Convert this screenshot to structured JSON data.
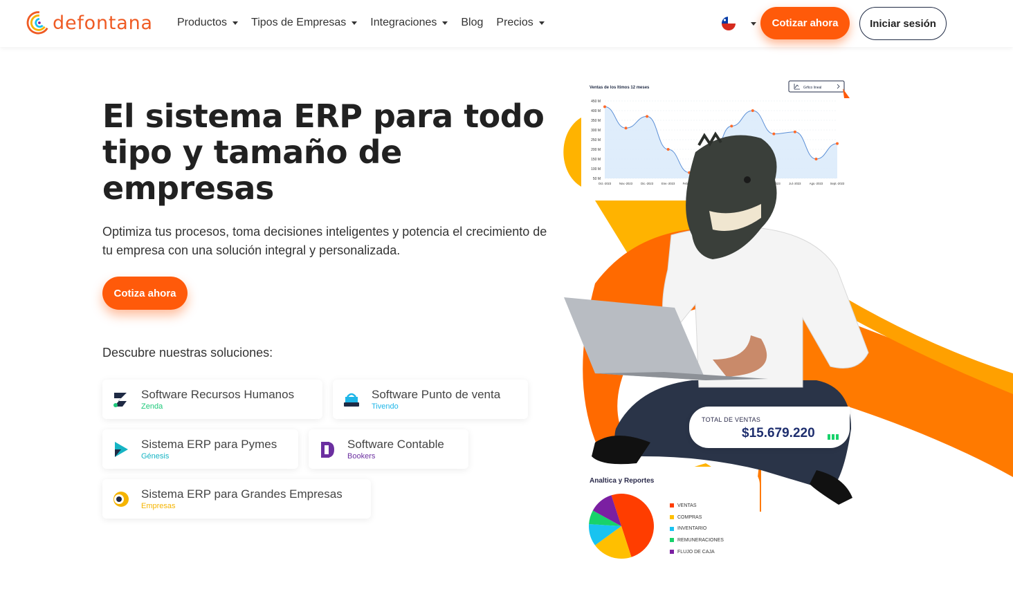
{
  "brand": {
    "name": "defontana"
  },
  "nav": {
    "items": [
      {
        "label": "Productos",
        "dropdown": true
      },
      {
        "label": "Tipos de Empresas",
        "dropdown": true
      },
      {
        "label": "Integraciones",
        "dropdown": true
      },
      {
        "label": "Blog",
        "dropdown": false
      },
      {
        "label": "Precios",
        "dropdown": true
      }
    ],
    "cta_label": "Cotizar ahora",
    "login_label": "Iniciar sesión",
    "country_icon": "chile-flag-icon"
  },
  "hero": {
    "title": "El sistema ERP para todo tipo y tamaño de empresas",
    "subtitle": "Optimiza tus procesos, toma decisiones inteligentes y potencia el crecimiento de tu empresa con una solución integral y personalizada.",
    "cta_label": "Cotiza ahora",
    "discover_label": "Descubre nuestras soluciones:"
  },
  "solutions": [
    {
      "title": "Software Recursos Humanos",
      "brand": "Zenda",
      "brand_color": "#1ec97a",
      "icon": "zenda-logo-icon"
    },
    {
      "title": "Software Punto de venta",
      "brand": "Tivendo",
      "brand_color": "#1fb6e8",
      "icon": "tivendo-logo-icon"
    },
    {
      "title": "Sistema ERP para Pymes",
      "brand": "Génesis",
      "brand_color": "#16b4c4",
      "icon": "genesis-logo-icon"
    },
    {
      "title": "Software Contable",
      "brand": "Bookers",
      "brand_color": "#6b2fa0",
      "icon": "bookers-logo-icon"
    },
    {
      "title": "Sistema ERP para Grandes Empresas",
      "brand": "Empresas",
      "brand_color": "#f5b400",
      "icon": "empresas-logo-icon"
    }
  ],
  "colors": {
    "accent": "#ff5a0a",
    "navy": "#1f2a44",
    "yellow": "#ffb300"
  },
  "illustration": {
    "chart_title": "Ventas de los ltimos 12 meses",
    "chart_toggle": "Grfico lineal",
    "sales_label": "TOTAL DE VENTAS",
    "sales_value": "$15.679.220",
    "pie_title": "Analtica y Reportes"
  },
  "chart_data": [
    {
      "type": "area",
      "title": "Ventas de los ltimos 12 meses",
      "y_tick_labels": [
        "450 M",
        "400 M",
        "350 M",
        "300 M",
        "250 M",
        "200 M",
        "150 M",
        "100 M",
        "50 M"
      ],
      "ylim": [
        50,
        450
      ],
      "categories": [
        "Oct.-2023",
        "Nov.-2023",
        "Dic.-2023",
        "Ene.-2023",
        "Feb.-2023",
        "Mar.-2023",
        "Abr.-2023",
        "May.-2023",
        "Jun.-2023",
        "Jul.-2023",
        "Ago.-2023",
        "Sept.-2023"
      ],
      "values": [
        420,
        310,
        370,
        200,
        80,
        150,
        320,
        400,
        280,
        290,
        150,
        230
      ]
    },
    {
      "type": "pie",
      "title": "Analtica y Reportes",
      "labels": [
        "VENTAS",
        "COMPRAS",
        "INVENTARIO",
        "REMUNERACIONES",
        "FLUJO DE CAJA"
      ],
      "values": [
        50,
        20,
        11,
        7,
        12
      ],
      "colors": [
        "#ff3d00",
        "#ffbf00",
        "#19c3f0",
        "#18d26b",
        "#7b1fa2"
      ]
    }
  ]
}
